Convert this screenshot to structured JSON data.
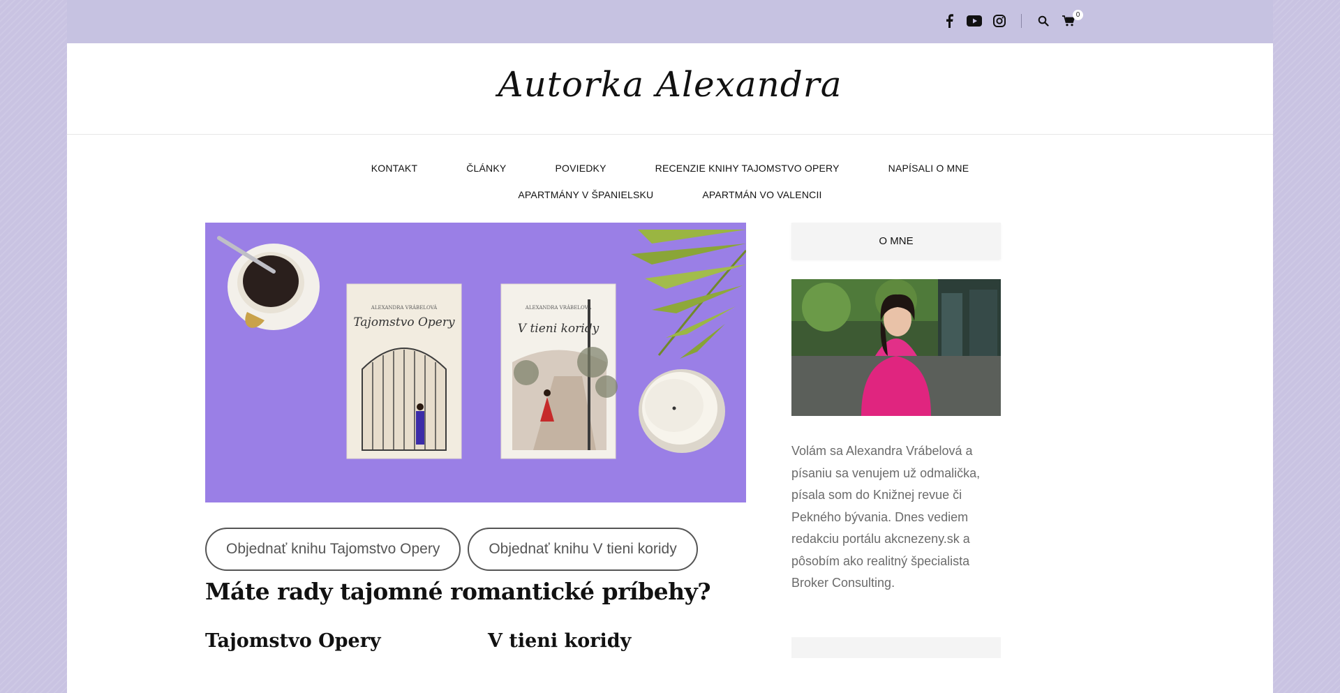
{
  "topbar": {
    "icons": [
      "facebook-icon",
      "youtube-icon",
      "instagram-icon",
      "search-icon",
      "cart-icon"
    ],
    "cart_count": "0"
  },
  "header": {
    "site_title": "Autorka Alexandra"
  },
  "nav": {
    "row1": [
      "KONTAKT",
      "ČLÁNKY",
      "POVIEDKY",
      "RECENZIE KNIHY TAJOMSTVO OPERY",
      "NAPÍSALI O MNE"
    ],
    "row2": [
      "APARTMÁNY V ŠPANIELSKU",
      "APARTMÁN VO VALENCII"
    ]
  },
  "hero": {
    "book1": {
      "author": "ALEXANDRA VRÁBELOVÁ",
      "title": "Tajomstvo Opery"
    },
    "book2": {
      "author": "ALEXANDRA VRÁBELOVÁ",
      "title": "V tieni koridy"
    }
  },
  "buttons": {
    "order1": "Objednať knihu Tajomstvo Opery",
    "order2": "Objednať knihu V tieni koridy"
  },
  "main": {
    "heading": "Máte rady tajomné romantické príbehy?",
    "sub1": "Tajomstvo Opery",
    "sub2": "V tieni koridy"
  },
  "sidebar": {
    "widget_title": "O MNE",
    "bio": "Volám sa Alexandra Vrábelová a písaniu sa venujem už odmalička, písala som do Knižnej revue či Pekného bývania. Dnes vediem redakciu portálu akcnezeny.sk a pôsobím ako realitný špecialista Broker Consulting."
  },
  "colors": {
    "background": "#c9c3e2",
    "topbar": "#c6c2e1",
    "hero_bg": "#9a7fe6",
    "button_border": "#555555",
    "text_gray": "#6b6b6b"
  }
}
